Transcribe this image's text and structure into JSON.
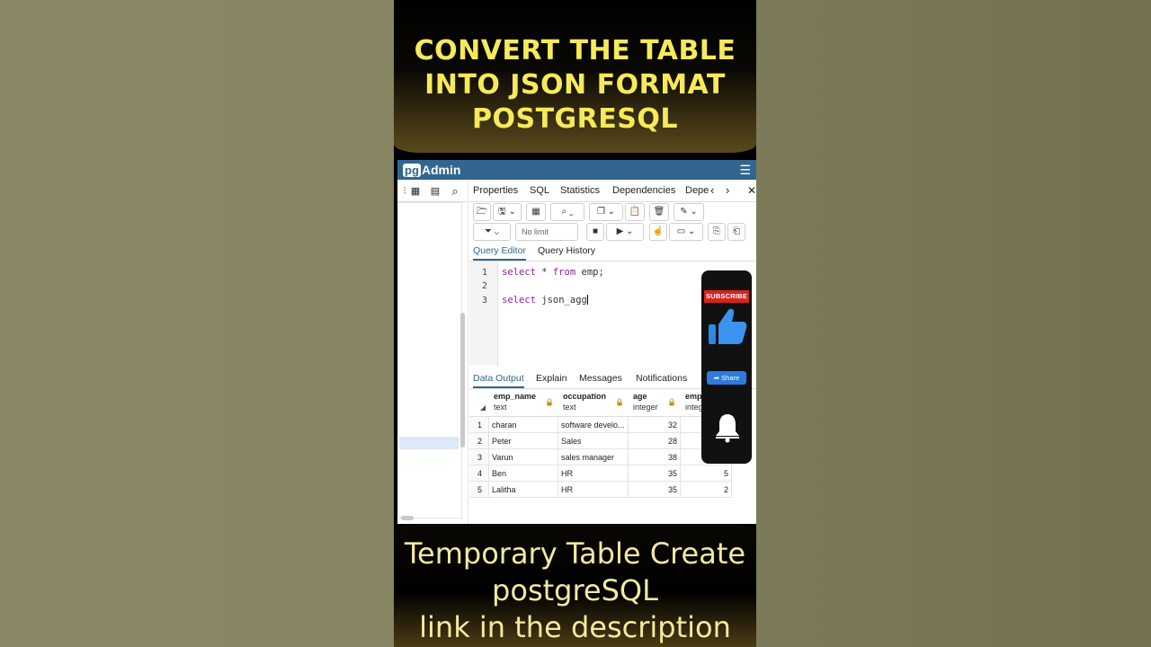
{
  "headline": [
    "CONVERT THE TABLE",
    "INTO JSON FORMAT",
    "POSTGRESQL"
  ],
  "app": {
    "logo_pg": "pg",
    "logo_name": "Admin"
  },
  "tabs": [
    "Properties",
    "SQL",
    "Statistics",
    "Dependencies",
    "Depe"
  ],
  "toolbar": {
    "limit_label": "No limit"
  },
  "editor_tabs": [
    "Query Editor",
    "Query History"
  ],
  "editor": {
    "line_numbers": [
      "1",
      "2",
      "3"
    ],
    "line1": {
      "kw1": "select",
      "mid1": " * ",
      "kw2": "from",
      "rest": " emp;"
    },
    "line3": {
      "prefix": "s",
      "cursor_kw": "elect",
      "rest": " json_agg"
    }
  },
  "output_tabs": [
    "Data Output",
    "Explain",
    "Messages",
    "Notifications"
  ],
  "grid": {
    "columns": [
      {
        "name": "emp_name",
        "type": "text"
      },
      {
        "name": "occupation",
        "type": "text"
      },
      {
        "name": "age",
        "type": "integer"
      },
      {
        "name": "emp_",
        "type": "integ"
      }
    ],
    "rows": [
      {
        "n": "1",
        "emp_name": "charan",
        "occupation": "software develo...",
        "age": "32",
        "emp_": ""
      },
      {
        "n": "2",
        "emp_name": "Peter",
        "occupation": "Sales",
        "age": "28",
        "emp_": ""
      },
      {
        "n": "3",
        "emp_name": "Varun",
        "occupation": "sales manager",
        "age": "38",
        "emp_": ""
      },
      {
        "n": "4",
        "emp_name": "Ben",
        "occupation": "HR",
        "age": "35",
        "emp_": "5"
      },
      {
        "n": "5",
        "emp_name": "Lalitha",
        "occupation": "HR",
        "age": "35",
        "emp_": "2"
      }
    ]
  },
  "widget": {
    "subscribe": "SUBSCRIBE",
    "share": "Share"
  },
  "bottom": [
    "Temporary Table Create",
    "postgreSQL",
    "link in the description"
  ],
  "colors": {
    "headline": "#f7ea5a",
    "pgadmin_blue": "#326690",
    "subscribe_red": "#d6231f",
    "keyword": "#8e1e9e"
  }
}
